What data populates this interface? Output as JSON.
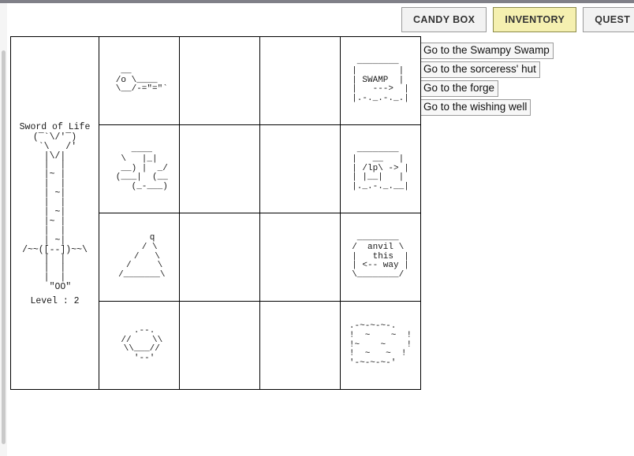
{
  "window": {
    "background_color": "#ffffff",
    "top_bar_color": "#808088"
  },
  "tabs": [
    {
      "label": "CANDY BOX",
      "active": false
    },
    {
      "label": "INVENTORY",
      "active": true
    },
    {
      "label": "QUEST",
      "active": false
    }
  ],
  "tab_colors": {
    "inactive_bg": "#f2f2f2",
    "active_bg": "#f5f0b0",
    "border": "#9a9a9a"
  },
  "nav_links": [
    {
      "label": "Go to the Swampy Swamp"
    },
    {
      "label": "Go to the sorceress' hut"
    },
    {
      "label": "Go to the forge"
    },
    {
      "label": "Go to the wishing well"
    }
  ],
  "inventory": {
    "equipped": {
      "name": "Sword of Life",
      "level_label": "Level : 2",
      "art": "  (‾`\\/'‾)\n   `\\   /'\n    |\\/|\n    |  |\n    |~ |\n    |  |\n    | ~|\n    |  |\n    | ~|\n    |~ |\n    |  |\n    | ~|\n/~~([--])~~\\\n    |  |\n    |  |\n    |  |\n     \"OO\""
    },
    "rows": [
      {
        "cells": [
          {
            "kind": "item",
            "art": "  __\n /o \\____\n \\__/-=\"=\"`"
          },
          {
            "kind": "empty",
            "art": ""
          },
          {
            "kind": "empty",
            "art": ""
          },
          {
            "kind": "location",
            "art": " ________\n|        |\n| SWAMP  |\n|   --->  |\n|.-._.-._.|"
          }
        ]
      },
      {
        "cells": [
          {
            "kind": "item",
            "art": "    ____\n  \\   |_|\n  __) |  _/\n (___|  (__\n    (_-___)"
          },
          {
            "kind": "empty",
            "art": ""
          },
          {
            "kind": "empty",
            "art": ""
          },
          {
            "kind": "location",
            "art": " ________\n|   __   |\n| /lp\\ -> |\n| |__|   |\n|._.-._.__|"
          }
        ]
      },
      {
        "cells": [
          {
            "kind": "item",
            "art": "     q\n    / \\\n   /   \\\n  /     \\\n /_______\\"
          },
          {
            "kind": "empty",
            "art": ""
          },
          {
            "kind": "empty",
            "art": ""
          },
          {
            "kind": "location",
            "art": " ________\n/  anvil \\\n|   this  |\n| <-- way |\n\\________/"
          }
        ]
      },
      {
        "cells": [
          {
            "kind": "item",
            "art": "  .--.\n //    \\\\\n \\\\___//\n  '--'"
          },
          {
            "kind": "empty",
            "art": ""
          },
          {
            "kind": "empty",
            "art": ""
          },
          {
            "kind": "location",
            "art": ".-~-~-~-.\n!  ~    ~  !\n!~    ~    !\n!  ~   ~  !\n'-~-~-~-'"
          }
        ]
      }
    ]
  }
}
